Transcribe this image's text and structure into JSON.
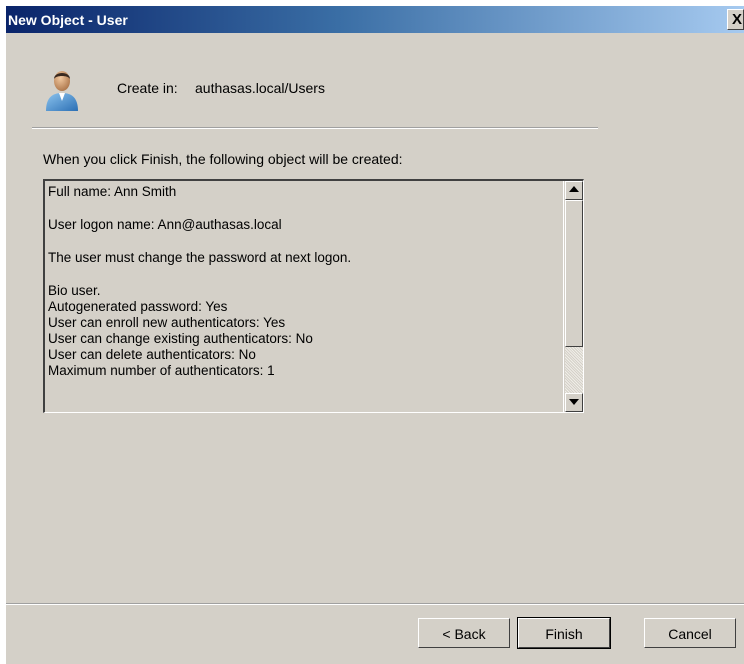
{
  "window": {
    "title": "New Object - User",
    "close_glyph": "X"
  },
  "header": {
    "icon": "user-icon",
    "create_in_label": "Create in:",
    "create_in_path": "authasas.local/Users"
  },
  "intro_text": "When you click Finish, the following object will be created:",
  "summary": {
    "full_name": "Full name: Ann Smith",
    "logon_name": "User logon name: Ann@authasas.local",
    "change_password": "The user must change the password at next logon.",
    "bio_lines": [
      "Bio user.",
      "Autogenerated password: Yes",
      "User can enroll new authenticators: Yes",
      "User can change existing authenticators: No",
      "User can delete authenticators: No",
      "Maximum number of authenticators: 1"
    ]
  },
  "buttons": {
    "back": "< Back",
    "finish": "Finish",
    "cancel": "Cancel"
  }
}
